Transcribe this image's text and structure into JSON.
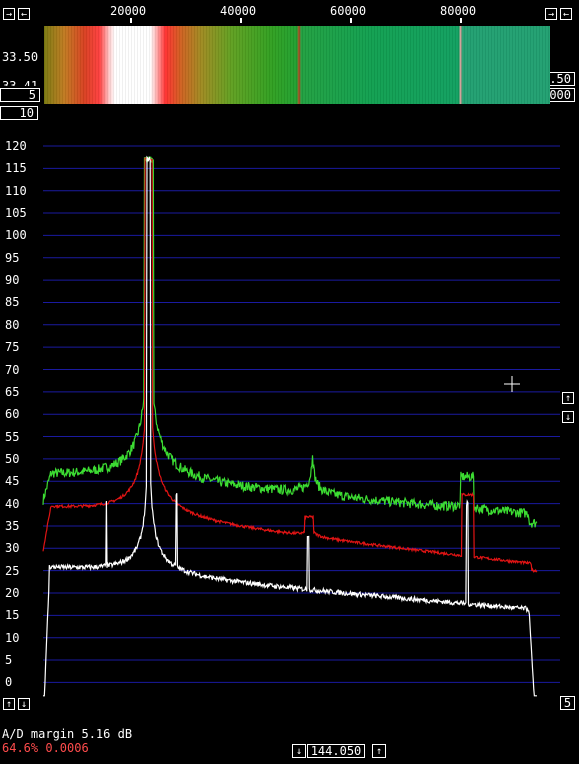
{
  "top_axis": {
    "ticks": [
      "20000",
      "40000",
      "60000",
      "80000"
    ]
  },
  "buttons": {
    "left_scroll": "→",
    "left_scroll2": "←",
    "right_scroll": "→",
    "right_scroll2": "←"
  },
  "waterfall": {
    "upper_value": "33.50",
    "lower_value": "33.41",
    "left_box": "5",
    "right_box_top": "0.50",
    "right_box_bottom": "0.000"
  },
  "spectrum": {
    "avg_box": "10",
    "y_ticks": [
      "120",
      "115",
      "110",
      "105",
      "100",
      "95",
      "90",
      "85",
      "80",
      "75",
      "70",
      "65",
      "60",
      "55",
      "50",
      "45",
      "40",
      "35",
      "30",
      "25",
      "20",
      "15",
      "10",
      "5",
      "0"
    ],
    "right_up": "↑",
    "right_down": "↓",
    "bottom_left_up": "↑",
    "bottom_left_down": "↓",
    "bottom_right_box": "5"
  },
  "status": {
    "ad_margin": "A/D margin 5.16 dB",
    "cpu_line": "64.6% 0.0006"
  },
  "frequency": {
    "down": "↓",
    "value": "144.050",
    "up": "↑"
  },
  "colors": {
    "grid": "#1a1aa0",
    "trace_green": "#3cdc32",
    "trace_red": "#e01414",
    "trace_white": "#ffffff"
  }
}
